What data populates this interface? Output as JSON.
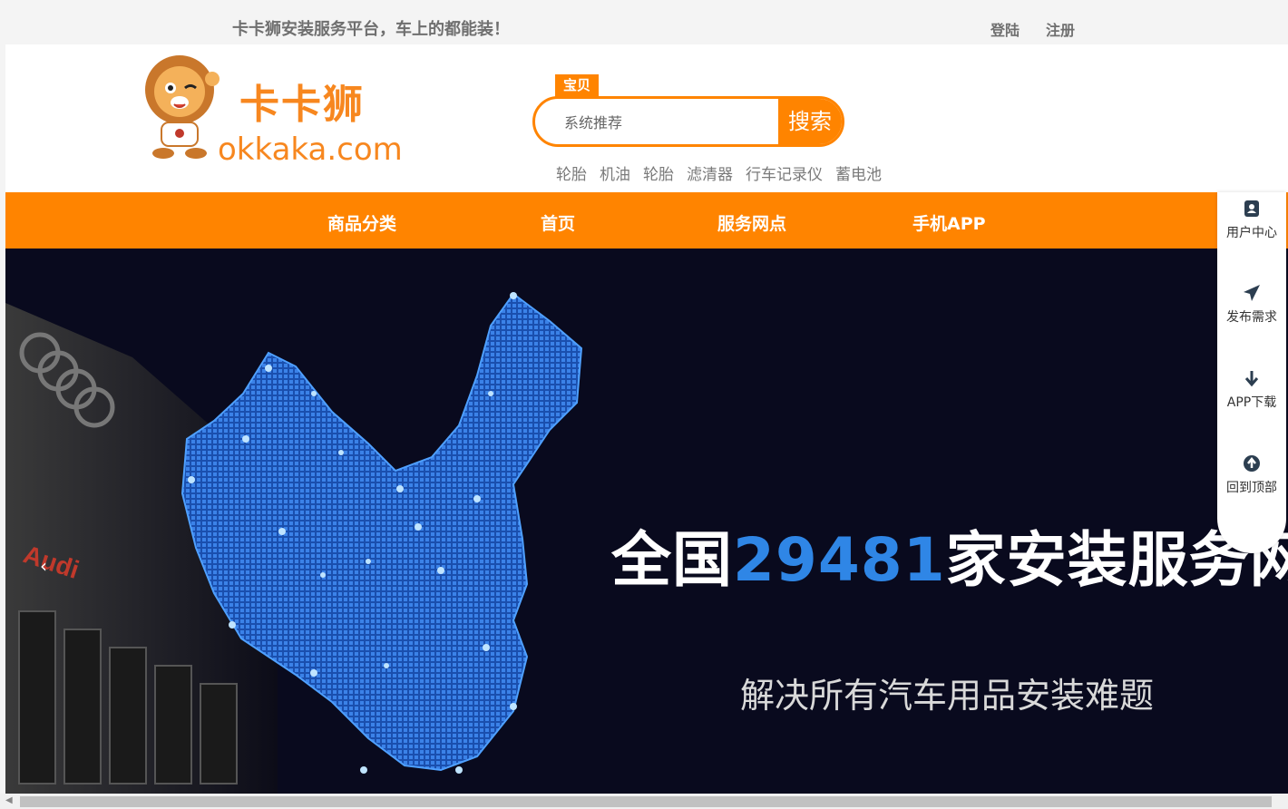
{
  "topbar": {
    "slogan": "卡卡狮安装服务平台，车上的都能装！",
    "login": "登陆",
    "register": "注册"
  },
  "logo": {
    "name_cn": "卡卡狮",
    "name_en": "okkaka.com"
  },
  "search": {
    "tag": "宝贝",
    "placeholder": "系统推荐",
    "button": "搜索",
    "hot_links": [
      "轮胎",
      "机油",
      "轮胎",
      "滤清器",
      "行车记录仪",
      "蓄电池"
    ]
  },
  "nav": {
    "items": [
      "商品分类",
      "首页",
      "服务网点",
      "手机APP"
    ]
  },
  "banner": {
    "headline_pre": "全国",
    "headline_num": "29481",
    "headline_post": "家安装服务网点",
    "subline": "解决所有汽车用品安装难题",
    "brand_mark": "Audi"
  },
  "side": {
    "items": [
      {
        "label": "用户中心",
        "icon": "user-card-icon"
      },
      {
        "label": "发布需求",
        "icon": "paper-plane-icon"
      },
      {
        "label": "APP下载",
        "icon": "arrow-down-icon"
      },
      {
        "label": "回到顶部",
        "icon": "arrow-up-circle-icon"
      }
    ]
  },
  "colors": {
    "accent": "#ff8400",
    "banner_bg": "#090a1e",
    "highlight": "#2f86e6"
  }
}
